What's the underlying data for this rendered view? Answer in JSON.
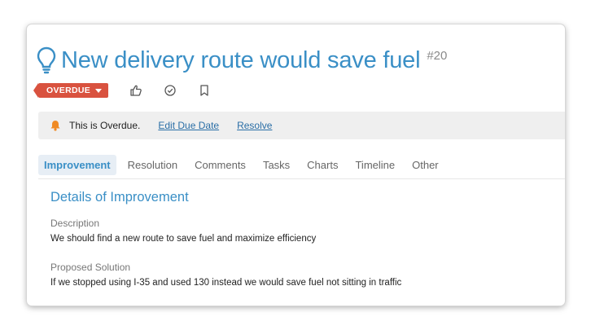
{
  "issue": {
    "title": "New delivery route would save fuel",
    "number": "#20",
    "status_badge": "OVERDUE",
    "icon": "lightbulb-icon"
  },
  "actions": [
    {
      "name": "like",
      "icon": "thumbs-up-icon"
    },
    {
      "name": "complete",
      "icon": "check-circle-icon"
    },
    {
      "name": "bookmark",
      "icon": "bookmark-icon"
    }
  ],
  "notice": {
    "text": "This is Overdue.",
    "edit_link": "Edit Due Date",
    "resolve_link": "Resolve",
    "icon": "bell-icon"
  },
  "tabs": [
    {
      "label": "Improvement",
      "active": true
    },
    {
      "label": "Resolution",
      "active": false
    },
    {
      "label": "Comments",
      "active": false
    },
    {
      "label": "Tasks",
      "active": false
    },
    {
      "label": "Charts",
      "active": false
    },
    {
      "label": "Timeline",
      "active": false
    },
    {
      "label": "Other",
      "active": false
    }
  ],
  "details": {
    "heading": "Details of Improvement",
    "description_label": "Description",
    "description_value": "We should find a new route to save fuel and maximize efficiency",
    "solution_label": "Proposed Solution",
    "solution_value": "If we stopped using I-35 and used 130 instead we would save fuel not sitting in traffic"
  },
  "colors": {
    "accent": "#3a8fc6",
    "overdue": "#d9523f",
    "bell": "#f08a24",
    "notice_bg": "#efefef"
  }
}
